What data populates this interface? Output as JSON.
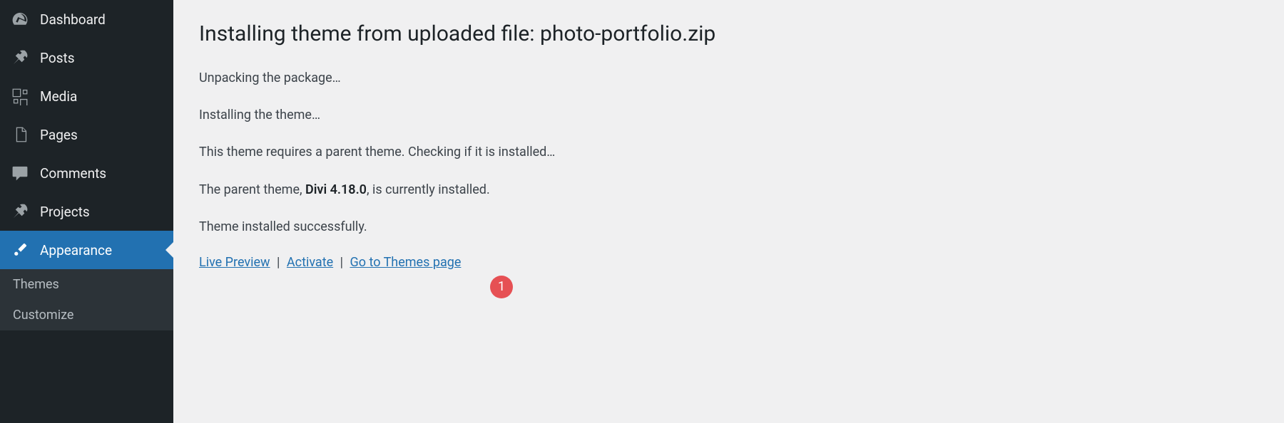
{
  "sidebar": {
    "items": [
      {
        "label": "Dashboard"
      },
      {
        "label": "Posts"
      },
      {
        "label": "Media"
      },
      {
        "label": "Pages"
      },
      {
        "label": "Comments"
      },
      {
        "label": "Projects"
      },
      {
        "label": "Appearance"
      }
    ],
    "subitems": [
      {
        "label": "Themes"
      },
      {
        "label": "Customize"
      }
    ]
  },
  "main": {
    "title": "Installing theme from uploaded file: photo-portfolio.zip",
    "status": [
      "Unpacking the package…",
      "Installing the theme…",
      "This theme requires a parent theme. Checking if it is installed…"
    ],
    "parent_theme_prefix": "The parent theme, ",
    "parent_theme_name": "Divi 4.18.0",
    "parent_theme_suffix": ", is currently installed.",
    "success": "Theme installed successfully.",
    "actions": {
      "live_preview": "Live Preview",
      "activate": "Activate",
      "themes_page": "Go to Themes page"
    },
    "badge": "1"
  }
}
